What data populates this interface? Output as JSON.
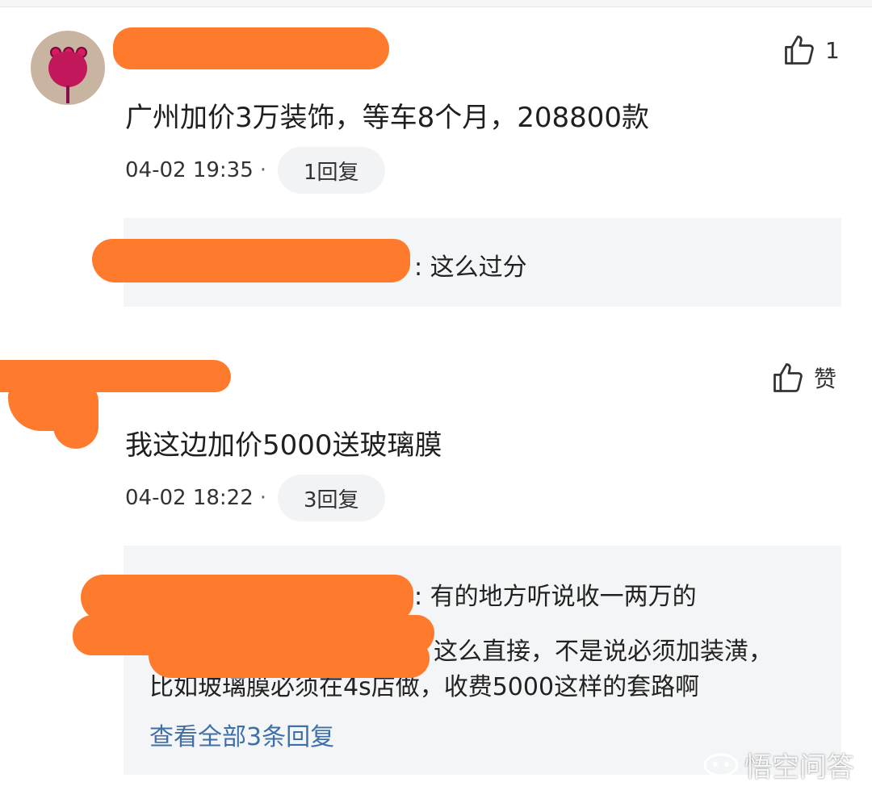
{
  "colors": {
    "redaction": "#fe7a2c",
    "link": "#3f6fa8",
    "reply_bg": "#f4f5f6"
  },
  "comments": [
    {
      "avatar": "flower-avatar",
      "text": "广州加价3万装饰，等车8个月，208800款",
      "time": "04-02 19:35",
      "separator": "·",
      "reply_count": "1回复",
      "like_icon": "thumbs-up-icon",
      "like_label": "1",
      "replies": [
        {
          "text": ": 这么过分"
        }
      ]
    },
    {
      "avatar": "redacted-avatar",
      "text": "我这边加价5000送玻璃膜",
      "time": "04-02 18:22",
      "separator": "·",
      "reply_count": "3回复",
      "like_icon": "thumbs-up-icon",
      "like_label": "赞",
      "replies": [
        {
          "text": ": 有的地方听说收一两万的"
        },
        {
          "text": "这么直接，不是说必须加装潢，",
          "continuation": "比如玻璃膜必须在4s店做，收费5000这样的套路啊"
        }
      ],
      "view_all": "查看全部3条回复"
    }
  ],
  "watermark": {
    "icon": "wukong-logo-icon",
    "text": "悟空问答"
  }
}
